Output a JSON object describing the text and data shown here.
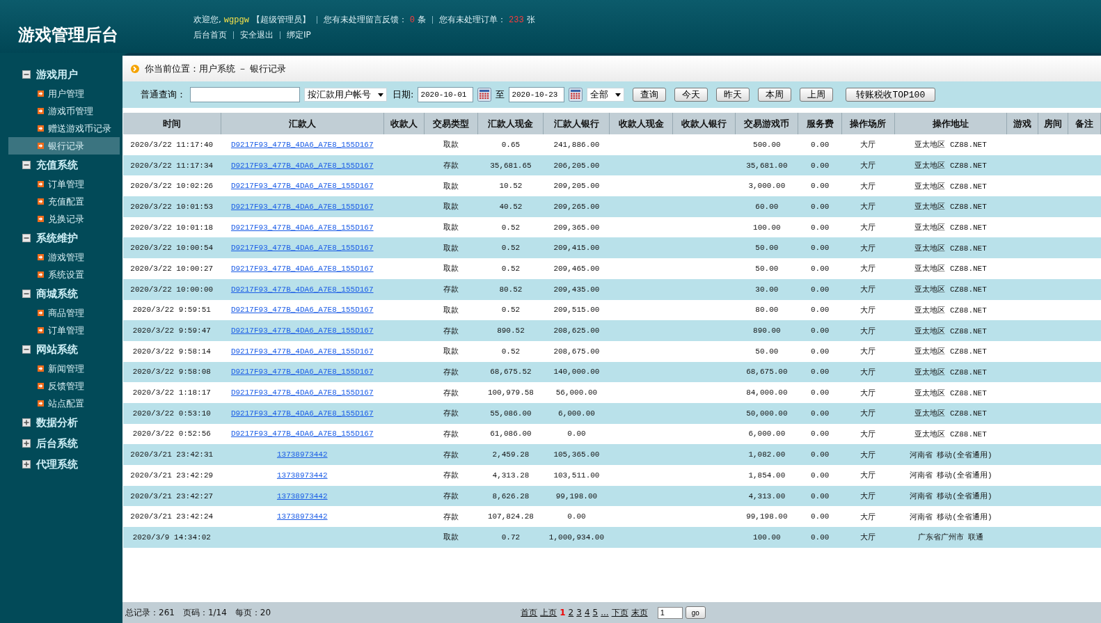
{
  "header": {
    "title": "游戏管理后台",
    "welcome": "欢迎您,",
    "username": "wgpgw",
    "role": "【超级管理员】",
    "feedback_label": "您有未处理留言反馈：",
    "feedback_count": "0",
    "feedback_unit": "条",
    "orders_label": "您有未处理订单：",
    "orders_count": "233",
    "orders_unit": "张",
    "links": [
      "后台首页",
      "安全退出",
      "绑定IP"
    ]
  },
  "sidebar": {
    "groups": [
      {
        "label": "游戏用户",
        "expanded": true,
        "items": [
          {
            "label": "用户管理",
            "selected": false
          },
          {
            "label": "游戏币管理",
            "selected": false
          },
          {
            "label": "赠送游戏币记录",
            "selected": false
          },
          {
            "label": "银行记录",
            "selected": true
          }
        ]
      },
      {
        "label": "充值系统",
        "expanded": true,
        "items": [
          {
            "label": "订单管理",
            "selected": false
          },
          {
            "label": "充值配置",
            "selected": false
          },
          {
            "label": "兑换记录",
            "selected": false
          }
        ]
      },
      {
        "label": "系统维护",
        "expanded": true,
        "items": [
          {
            "label": "游戏管理",
            "selected": false
          },
          {
            "label": "系统设置",
            "selected": false
          }
        ]
      },
      {
        "label": "商城系统",
        "expanded": true,
        "items": [
          {
            "label": "商品管理",
            "selected": false
          },
          {
            "label": "订单管理",
            "selected": false
          }
        ]
      },
      {
        "label": "网站系统",
        "expanded": true,
        "items": [
          {
            "label": "新闻管理",
            "selected": false
          },
          {
            "label": "反馈管理",
            "selected": false
          },
          {
            "label": "站点配置",
            "selected": false
          }
        ]
      },
      {
        "label": "数据分析",
        "expanded": false
      },
      {
        "label": "后台系统",
        "expanded": false
      },
      {
        "label": "代理系统",
        "expanded": false
      }
    ]
  },
  "breadcrumb": "你当前位置：用户系统 － 银行记录",
  "filter": {
    "query_label": "普通查询：",
    "query_type": "按汇款用户帐号",
    "date_label": "日期:",
    "date_from": "2020-10-01",
    "date_sep": "至",
    "date_to": "2020-10-23",
    "trade_type": "全部",
    "buttons": [
      "查询",
      "今天",
      "昨天",
      "本周",
      "上周",
      "转账税收TOP100"
    ]
  },
  "table": {
    "columns": [
      "时间",
      "汇款人",
      "收款人",
      "交易类型",
      "汇款人现金",
      "汇款人银行",
      "收款人现金",
      "收款人银行",
      "交易游戏币",
      "服务费",
      "操作场所",
      "操作地址",
      "游戏",
      "房间",
      "备注"
    ],
    "rows": [
      [
        "2020/3/22 11:17:40",
        "D9217F93_477B_4DA6_A7E8_155D167",
        null,
        "取款",
        "0.65",
        "241,886.00",
        null,
        null,
        "500.00",
        "0.00",
        "大厅",
        "亚太地区 CZ88.NET",
        null,
        null,
        null
      ],
      [
        "2020/3/22 11:17:34",
        "D9217F93_477B_4DA6_A7E8_155D167",
        null,
        "存款",
        "35,681.65",
        "206,205.00",
        null,
        null,
        "35,681.00",
        "0.00",
        "大厅",
        "亚太地区 CZ88.NET",
        null,
        null,
        null
      ],
      [
        "2020/3/22 10:02:26",
        "D9217F93_477B_4DA6_A7E8_155D167",
        null,
        "取款",
        "10.52",
        "209,205.00",
        null,
        null,
        "3,000.00",
        "0.00",
        "大厅",
        "亚太地区 CZ88.NET",
        null,
        null,
        null
      ],
      [
        "2020/3/22 10:01:53",
        "D9217F93_477B_4DA6_A7E8_155D167",
        null,
        "取款",
        "40.52",
        "209,265.00",
        null,
        null,
        "60.00",
        "0.00",
        "大厅",
        "亚太地区 CZ88.NET",
        null,
        null,
        null
      ],
      [
        "2020/3/22 10:01:18",
        "D9217F93_477B_4DA6_A7E8_155D167",
        null,
        "取款",
        "0.52",
        "209,365.00",
        null,
        null,
        "100.00",
        "0.00",
        "大厅",
        "亚太地区 CZ88.NET",
        null,
        null,
        null
      ],
      [
        "2020/3/22 10:00:54",
        "D9217F93_477B_4DA6_A7E8_155D167",
        null,
        "取款",
        "0.52",
        "209,415.00",
        null,
        null,
        "50.00",
        "0.00",
        "大厅",
        "亚太地区 CZ88.NET",
        null,
        null,
        null
      ],
      [
        "2020/3/22 10:00:27",
        "D9217F93_477B_4DA6_A7E8_155D167",
        null,
        "取款",
        "0.52",
        "209,465.00",
        null,
        null,
        "50.00",
        "0.00",
        "大厅",
        "亚太地区 CZ88.NET",
        null,
        null,
        null
      ],
      [
        "2020/3/22 10:00:00",
        "D9217F93_477B_4DA6_A7E8_155D167",
        null,
        "存款",
        "80.52",
        "209,435.00",
        null,
        null,
        "30.00",
        "0.00",
        "大厅",
        "亚太地区 CZ88.NET",
        null,
        null,
        null
      ],
      [
        "2020/3/22 9:59:51",
        "D9217F93_477B_4DA6_A7E8_155D167",
        null,
        "取款",
        "0.52",
        "209,515.00",
        null,
        null,
        "80.00",
        "0.00",
        "大厅",
        "亚太地区 CZ88.NET",
        null,
        null,
        null
      ],
      [
        "2020/3/22 9:59:47",
        "D9217F93_477B_4DA6_A7E8_155D167",
        null,
        "存款",
        "890.52",
        "208,625.00",
        null,
        null,
        "890.00",
        "0.00",
        "大厅",
        "亚太地区 CZ88.NET",
        null,
        null,
        null
      ],
      [
        "2020/3/22 9:58:14",
        "D9217F93_477B_4DA6_A7E8_155D167",
        null,
        "取款",
        "0.52",
        "208,675.00",
        null,
        null,
        "50.00",
        "0.00",
        "大厅",
        "亚太地区 CZ88.NET",
        null,
        null,
        null
      ],
      [
        "2020/3/22 9:58:08",
        "D9217F93_477B_4DA6_A7E8_155D167",
        null,
        "存款",
        "68,675.52",
        "140,000.00",
        null,
        null,
        "68,675.00",
        "0.00",
        "大厅",
        "亚太地区 CZ88.NET",
        null,
        null,
        null
      ],
      [
        "2020/3/22 1:18:17",
        "D9217F93_477B_4DA6_A7E8_155D167",
        null,
        "存款",
        "100,979.58",
        "56,000.00",
        null,
        null,
        "84,000.00",
        "0.00",
        "大厅",
        "亚太地区 CZ88.NET",
        null,
        null,
        null
      ],
      [
        "2020/3/22 0:53:10",
        "D9217F93_477B_4DA6_A7E8_155D167",
        null,
        "存款",
        "55,086.00",
        "6,000.00",
        null,
        null,
        "50,000.00",
        "0.00",
        "大厅",
        "亚太地区 CZ88.NET",
        null,
        null,
        null
      ],
      [
        "2020/3/22 0:52:56",
        "D9217F93_477B_4DA6_A7E8_155D167",
        null,
        "存款",
        "61,086.00",
        "0.00",
        null,
        null,
        "6,000.00",
        "0.00",
        "大厅",
        "亚太地区 CZ88.NET",
        null,
        null,
        null
      ],
      [
        "2020/3/21 23:42:31",
        "13738973442",
        null,
        "存款",
        "2,459.28",
        "105,365.00",
        null,
        null,
        "1,082.00",
        "0.00",
        "大厅",
        "河南省 移动(全省通用)",
        null,
        null,
        null
      ],
      [
        "2020/3/21 23:42:29",
        "13738973442",
        null,
        "存款",
        "4,313.28",
        "103,511.00",
        null,
        null,
        "1,854.00",
        "0.00",
        "大厅",
        "河南省 移动(全省通用)",
        null,
        null,
        null
      ],
      [
        "2020/3/21 23:42:27",
        "13738973442",
        null,
        "存款",
        "8,626.28",
        "99,198.00",
        null,
        null,
        "4,313.00",
        "0.00",
        "大厅",
        "河南省 移动(全省通用)",
        null,
        null,
        null
      ],
      [
        "2020/3/21 23:42:24",
        "13738973442",
        null,
        "存款",
        "107,824.28",
        "0.00",
        null,
        null,
        "99,198.00",
        "0.00",
        "大厅",
        "河南省 移动(全省通用)",
        null,
        null,
        null
      ],
      [
        "2020/3/9 14:34:02",
        null,
        null,
        "取款",
        "0.72",
        "1,000,934.00",
        null,
        null,
        "100.00",
        "0.00",
        "大厅",
        "广东省广州市 联通",
        null,
        null,
        null
      ]
    ]
  },
  "footer": {
    "total": "总记录：261",
    "page": "页码：1/14",
    "per_page": "每页：20",
    "pages": [
      {
        "label": "首页",
        "selected": false
      },
      {
        "label": "上页",
        "selected": false
      },
      {
        "label": "1",
        "selected": true
      },
      {
        "label": "2",
        "selected": false
      },
      {
        "label": "3",
        "selected": false
      },
      {
        "label": "4",
        "selected": false
      },
      {
        "label": "5",
        "selected": false
      },
      {
        "label": "...",
        "selected": false
      },
      {
        "label": "下页",
        "selected": false
      },
      {
        "label": "末页",
        "selected": false
      }
    ],
    "page_input": "1",
    "go": "go"
  }
}
